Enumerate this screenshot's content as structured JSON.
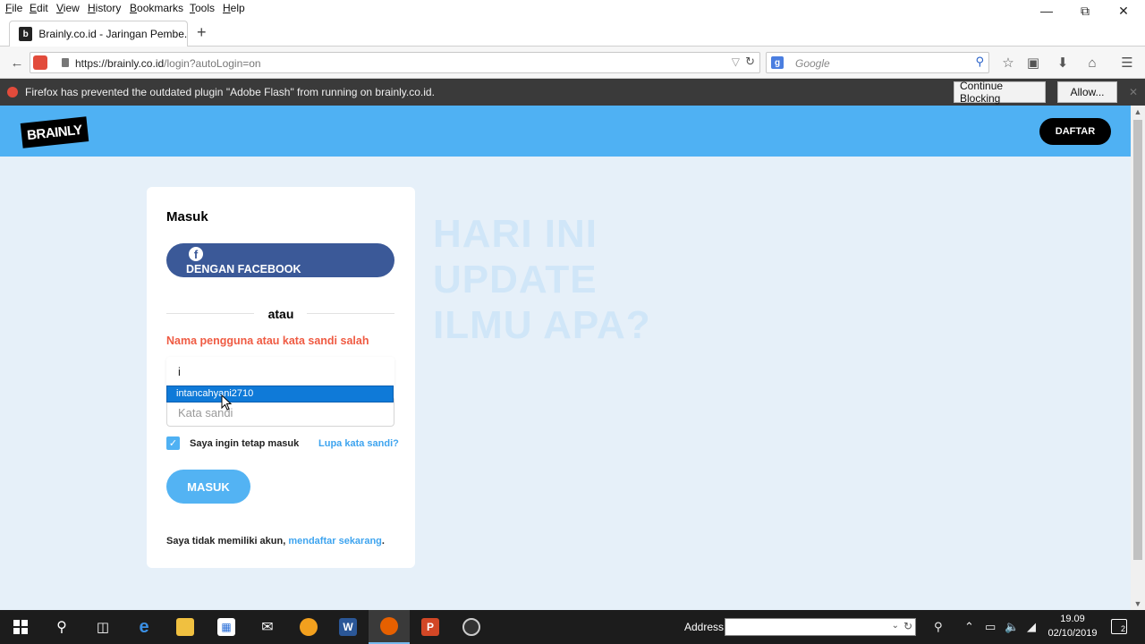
{
  "menu": [
    "File",
    "Edit",
    "View",
    "History",
    "Bookmarks",
    "Tools",
    "Help"
  ],
  "tab": {
    "title": "Brainly.co.id - Jaringan Pembe..."
  },
  "navbar": {
    "url_host": "https://brainly.co.id",
    "url_path": "/login?autoLogin=on",
    "search_placeholder": "Google"
  },
  "notification": {
    "text": "Firefox has prevented the outdated plugin \"Adobe Flash\" from running on brainly.co.id.",
    "continue_label": "Continue Blocking",
    "allow_label": "Allow..."
  },
  "site": {
    "logo": "BRAINLY",
    "signup_button": "DAFTAR",
    "hero_lines": [
      "HARI INI",
      "UPDATE",
      "ILMU APA?"
    ]
  },
  "login": {
    "title": "Masuk",
    "facebook_label": "DENGAN FACEBOOK",
    "or_text": "atau",
    "error": "Nama pengguna atau kata sandi salah",
    "username_value": "i",
    "password_placeholder": "Kata sandi",
    "autocomplete_item": "intancahyani2710",
    "remember_label": "Saya ingin tetap masuk",
    "remember_checked": true,
    "forgot_link": "Lupa kata sandi?",
    "submit_label": "MASUK",
    "signup_prefix": "Saya tidak memiliki akun, ",
    "signup_link": "mendaftar sekarang",
    "signup_suffix": "."
  },
  "taskbar": {
    "address_label": "Address",
    "time": "19.09",
    "date": "02/10/2019",
    "notification_count": "2"
  },
  "colors": {
    "header": "#4fb1f3",
    "facebook": "#3b5998",
    "error": "#ef5b43",
    "link": "#3ea4ef",
    "page_bg": "#e6f0f9"
  }
}
